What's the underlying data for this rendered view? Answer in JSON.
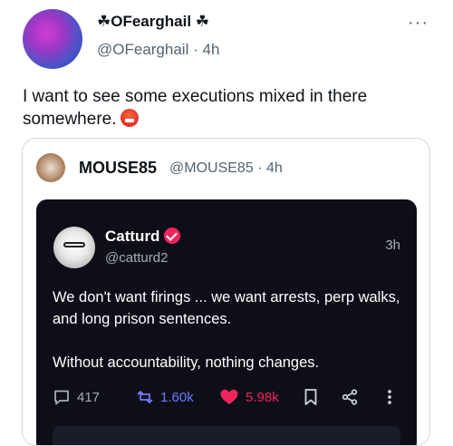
{
  "tweet": {
    "author": {
      "display_name": "☘OFearghail ☘",
      "handle": "@OFearghail",
      "time": "4h"
    },
    "text": "I want to see some executions mixed in there somewhere.",
    "emoji": "face-with-symbols-on-mouth",
    "more_label": "···"
  },
  "quote": {
    "author": {
      "display_name": "MOUSE85",
      "handle": "@MOUSE85",
      "time": "4h"
    },
    "embedded_post": {
      "author": {
        "display_name": "Catturd",
        "handle": "@catturd2",
        "time": "3h",
        "verified_color": "#f0245c"
      },
      "paragraphs": [
        "We don't want firings ... we want arrests, perp walks, and long prison sentences.",
        "Without accountability, nothing changes."
      ],
      "actions": {
        "replies": "417",
        "reposts": "1.60k",
        "likes": "5.98k"
      },
      "colors": {
        "background": "#0e0e18",
        "repost": "#6b7cff",
        "like": "#f0245c"
      }
    }
  },
  "icons": [
    "reply-icon",
    "repost-icon",
    "heart-icon",
    "bookmark-icon",
    "share-icon",
    "vertical-dots-icon"
  ]
}
